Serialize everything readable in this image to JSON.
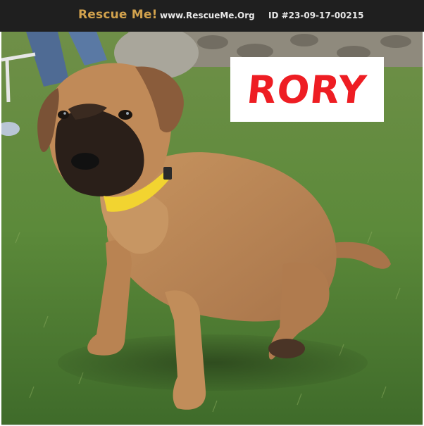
{
  "header": {
    "brand": "Rescue Me!",
    "site": "www.RescueMe.Org",
    "pet_id": "ID #23-09-17-00215"
  },
  "photo": {
    "subject": "dog-photo",
    "name_card": "RORY"
  },
  "colors": {
    "header_bg": "#1f1f1f",
    "brand": "#d2a24d",
    "header_text": "#e8e8e8",
    "name_text": "#ee1d23"
  }
}
